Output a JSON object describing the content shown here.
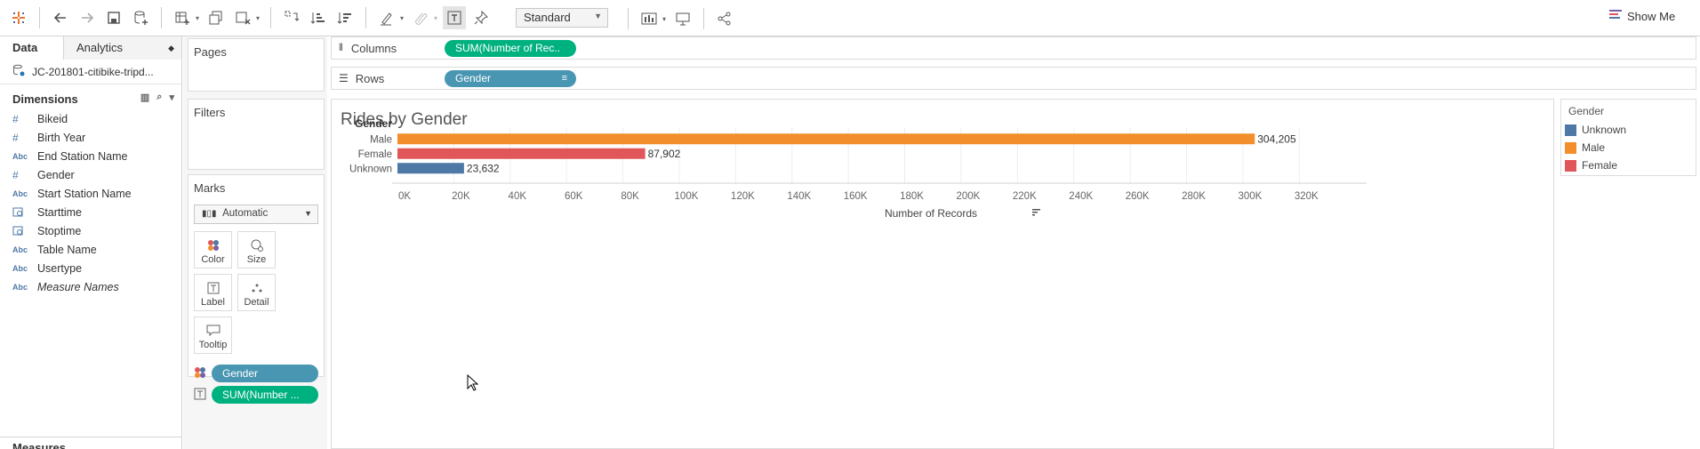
{
  "toolbar": {
    "mark_fit_select": "Standard",
    "show_me_label": "Show Me"
  },
  "data_pane": {
    "tabs": {
      "data": "Data",
      "analytics": "Analytics"
    },
    "datasource": "JC-201801-citibike-tripd...",
    "dimensions_header": "Dimensions",
    "dimensions": [
      {
        "type": "#",
        "name": "Bikeid"
      },
      {
        "type": "#",
        "name": "Birth Year"
      },
      {
        "type": "Abc",
        "name": "End Station Name"
      },
      {
        "type": "#",
        "name": "Gender"
      },
      {
        "type": "Abc",
        "name": "Start Station Name"
      },
      {
        "type": "date",
        "name": "Starttime"
      },
      {
        "type": "date",
        "name": "Stoptime"
      },
      {
        "type": "Abc",
        "name": "Table Name"
      },
      {
        "type": "Abc",
        "name": "Usertype"
      },
      {
        "type": "Abc",
        "name": "Measure Names"
      }
    ],
    "measures_header": "Measures"
  },
  "cards": {
    "pages": "Pages",
    "filters": "Filters",
    "marks": {
      "title": "Marks",
      "mark_type": "Automatic",
      "buttons": {
        "color": "Color",
        "size": "Size",
        "label": "Label",
        "detail": "Detail",
        "tooltip": "Tooltip"
      },
      "pills": {
        "color_pill": "Gender",
        "label_pill": "SUM(Number ..."
      }
    }
  },
  "shelves": {
    "columns": {
      "label": "Columns",
      "pill": "SUM(Number of Rec.."
    },
    "rows": {
      "label": "Rows",
      "pill": "Gender"
    }
  },
  "view": {
    "title": "Rides by Gender"
  },
  "legend": {
    "title": "Gender",
    "items": [
      {
        "label": "Unknown",
        "color": "#4e79a7"
      },
      {
        "label": "Male",
        "color": "#f28e2b"
      },
      {
        "label": "Female",
        "color": "#e15759"
      }
    ]
  },
  "chart_data": {
    "type": "bar",
    "orientation": "horizontal",
    "title": "Rides by Gender",
    "row_header": "Gender",
    "xlabel": "Number of Records",
    "categories": [
      "Male",
      "Female",
      "Unknown"
    ],
    "values": [
      304205,
      87902,
      23632
    ],
    "data_labels": [
      "304,205",
      "87,902",
      "23,632"
    ],
    "colors": [
      "#f28e2b",
      "#e15759",
      "#4e79a7"
    ],
    "xlim": [
      0,
      330000
    ],
    "xticks": [
      0,
      20000,
      40000,
      60000,
      80000,
      100000,
      120000,
      140000,
      160000,
      180000,
      200000,
      220000,
      240000,
      260000,
      280000,
      300000,
      320000
    ],
    "xtick_labels": [
      "0K",
      "20K",
      "40K",
      "60K",
      "80K",
      "100K",
      "120K",
      "140K",
      "160K",
      "180K",
      "200K",
      "220K",
      "240K",
      "260K",
      "280K",
      "300K",
      "320K"
    ],
    "grid": true,
    "legend": "right"
  }
}
